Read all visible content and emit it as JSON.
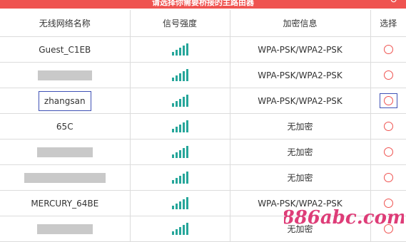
{
  "header": {
    "title": "请选择你需要桥接的主路由器",
    "refresh_icon": "refresh-icon"
  },
  "columns": [
    "无线网络名称",
    "信号强度",
    "加密信息",
    "选择"
  ],
  "rows": [
    {
      "ssid": "Guest_C1EB",
      "security": "WPA-PSK/WPA2-PSK",
      "selected": false
    },
    {
      "ssid": "",
      "redacted": true,
      "security": "WPA-PSK/WPA2-PSK",
      "selected": false
    },
    {
      "ssid": "zhangsan",
      "boxed": true,
      "security": "WPA-PSK/WPA2-PSK",
      "selected": true
    },
    {
      "ssid": "65C",
      "security": "无加密",
      "selected": false
    },
    {
      "ssid": "",
      "redacted": true,
      "security": "无加密",
      "selected": false
    },
    {
      "ssid": "",
      "redacted": true,
      "security": "无加密",
      "selected": false
    },
    {
      "ssid": "MERCURY_64BE",
      "security": "WPA-PSK/WPA2-PSK",
      "selected": false
    },
    {
      "ssid": "",
      "redacted": true,
      "security": "无加密",
      "selected": false
    }
  ],
  "watermark": {
    "text": "886abc.com"
  },
  "colors": {
    "accent": "#ef5350",
    "signal": "#26a69a",
    "focus": "#3f51b5"
  }
}
